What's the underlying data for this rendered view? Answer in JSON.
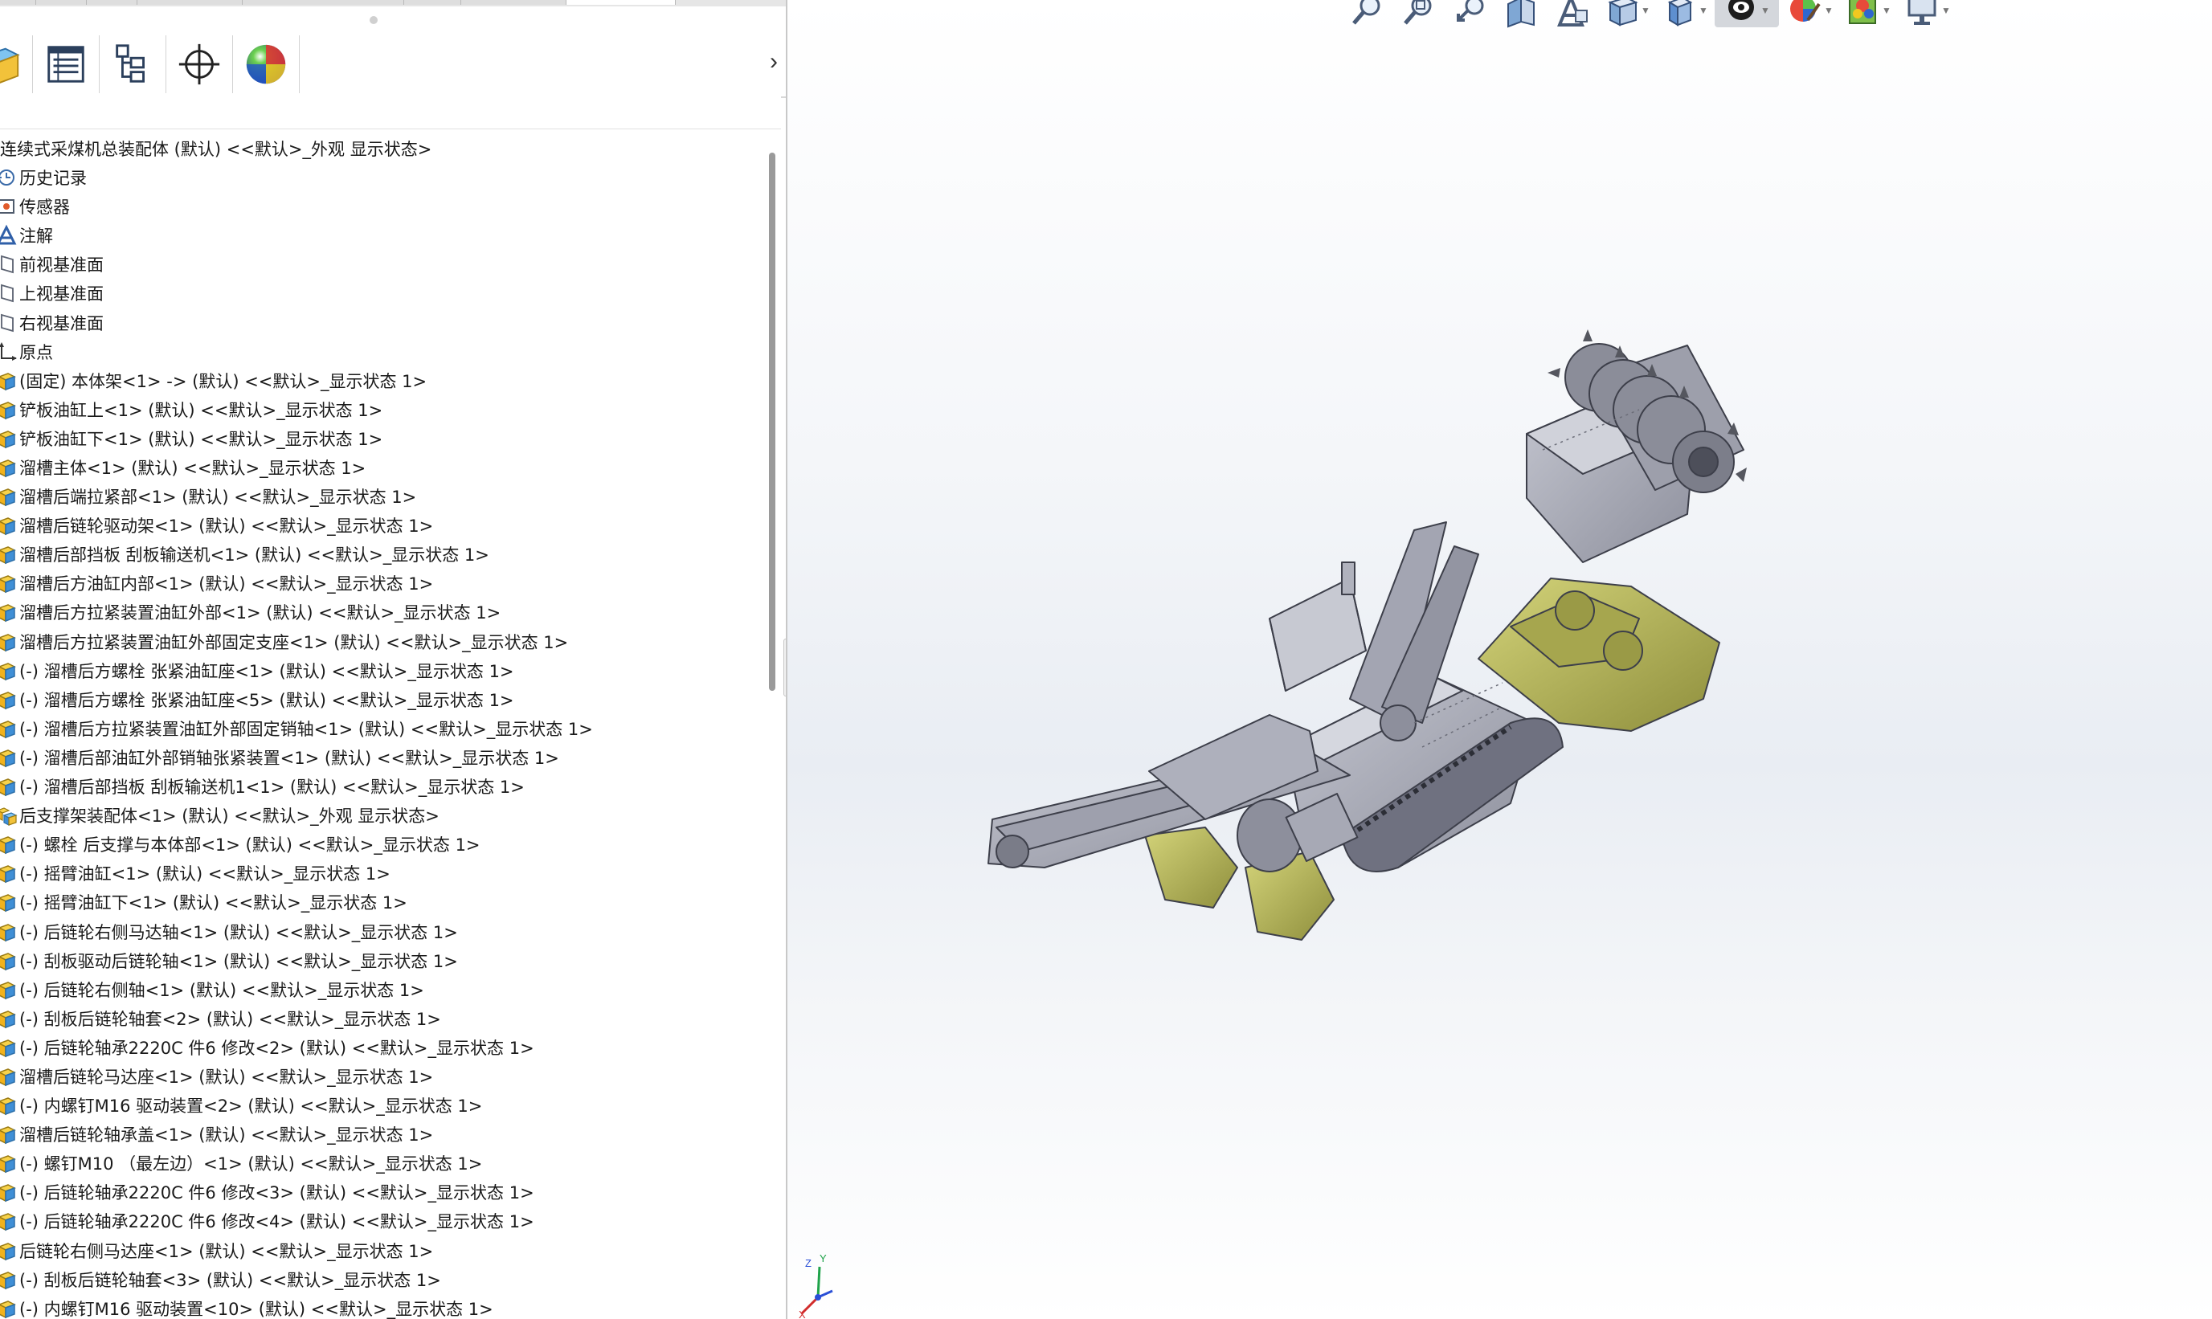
{
  "panel": {
    "icon_tabs": [
      {
        "name": "featuremanager-tab",
        "icon": "part-cube-icon"
      },
      {
        "name": "propertymanager-tab",
        "icon": "property-list-icon"
      },
      {
        "name": "configurationmanager-tab",
        "icon": "configuration-tree-icon"
      },
      {
        "name": "dimxpert-tab",
        "icon": "crosshair-icon"
      },
      {
        "name": "display-manager-tab",
        "icon": "color-sphere-icon"
      }
    ],
    "expand_glyph": "›",
    "filter_placeholder": ""
  },
  "tree": {
    "root": "连续式采煤机总装配体 (默认) <<默认>_外观 显示状态>",
    "items": [
      {
        "label": "历史记录",
        "icon": "history-icon"
      },
      {
        "label": "传感器",
        "icon": "sensor-icon"
      },
      {
        "label": "注解",
        "icon": "annotation-icon"
      },
      {
        "label": "前视基准面",
        "icon": "plane-icon"
      },
      {
        "label": "上视基准面",
        "icon": "plane-icon"
      },
      {
        "label": "右视基准面",
        "icon": "plane-icon"
      },
      {
        "label": "原点",
        "icon": "origin-icon"
      },
      {
        "label": "(固定) 本体架<1> -> (默认) <<默认>_显示状态 1>",
        "icon": "part-icon"
      },
      {
        "label": "铲板油缸上<1> (默认) <<默认>_显示状态 1>",
        "icon": "part-icon"
      },
      {
        "label": "铲板油缸下<1> (默认) <<默认>_显示状态 1>",
        "icon": "part-icon"
      },
      {
        "label": "溜槽主体<1> (默认) <<默认>_显示状态 1>",
        "icon": "part-icon"
      },
      {
        "label": "溜槽后端拉紧部<1> (默认) <<默认>_显示状态 1>",
        "icon": "part-icon"
      },
      {
        "label": "溜槽后链轮驱动架<1> (默认) <<默认>_显示状态 1>",
        "icon": "part-icon"
      },
      {
        "label": "溜槽后部挡板  刮板输送机<1> (默认) <<默认>_显示状态 1>",
        "icon": "part-icon"
      },
      {
        "label": "溜槽后方油缸内部<1> (默认) <<默认>_显示状态 1>",
        "icon": "part-icon"
      },
      {
        "label": "溜槽后方拉紧装置油缸外部<1> (默认) <<默认>_显示状态 1>",
        "icon": "part-icon"
      },
      {
        "label": "溜槽后方拉紧装置油缸外部固定支座<1> (默认) <<默认>_显示状态 1>",
        "icon": "part-icon"
      },
      {
        "label": "(-) 溜槽后方螺栓 张紧油缸座<1> (默认) <<默认>_显示状态 1>",
        "icon": "part-icon"
      },
      {
        "label": "(-) 溜槽后方螺栓 张紧油缸座<5> (默认) <<默认>_显示状态 1>",
        "icon": "part-icon"
      },
      {
        "label": "(-) 溜槽后方拉紧装置油缸外部固定销轴<1> (默认) <<默认>_显示状态 1>",
        "icon": "part-icon"
      },
      {
        "label": "(-) 溜槽后部油缸外部销轴张紧装置<1> (默认) <<默认>_显示状态 1>",
        "icon": "part-icon"
      },
      {
        "label": "(-) 溜槽后部挡板  刮板输送机1<1> (默认) <<默认>_显示状态 1>",
        "icon": "part-icon"
      },
      {
        "label": "后支撑架装配体<1> (默认) <<默认>_外观 显示状态>",
        "icon": "assembly-icon"
      },
      {
        "label": "(-) 螺栓 后支撑与本体部<1> (默认) <<默认>_显示状态 1>",
        "icon": "part-icon"
      },
      {
        "label": "(-) 摇臂油缸<1> (默认) <<默认>_显示状态 1>",
        "icon": "part-icon"
      },
      {
        "label": "(-) 摇臂油缸下<1> (默认) <<默认>_显示状态 1>",
        "icon": "part-icon"
      },
      {
        "label": "(-) 后链轮右侧马达轴<1> (默认) <<默认>_显示状态 1>",
        "icon": "part-icon"
      },
      {
        "label": "(-) 刮板驱动后链轮轴<1> (默认) <<默认>_显示状态 1>",
        "icon": "part-icon"
      },
      {
        "label": "(-) 后链轮右侧轴<1> (默认) <<默认>_显示状态 1>",
        "icon": "part-icon"
      },
      {
        "label": "(-) 刮板后链轮轴套<2> (默认) <<默认>_显示状态 1>",
        "icon": "part-icon"
      },
      {
        "label": "(-) 后链轮轴承2220C 件6  修改<2> (默认) <<默认>_显示状态 1>",
        "icon": "part-icon"
      },
      {
        "label": "溜槽后链轮马达座<1> (默认) <<默认>_显示状态 1>",
        "icon": "part-icon"
      },
      {
        "label": "(-) 内螺钉M16 驱动装置<2> (默认) <<默认>_显示状态 1>",
        "icon": "part-icon"
      },
      {
        "label": "溜槽后链轮轴承盖<1> (默认) <<默认>_显示状态 1>",
        "icon": "part-icon"
      },
      {
        "label": "(-) 螺钉M10  （最左边）<1> (默认) <<默认>_显示状态 1>",
        "icon": "part-icon"
      },
      {
        "label": "(-) 后链轮轴承2220C 件6  修改<3> (默认) <<默认>_显示状态 1>",
        "icon": "part-icon"
      },
      {
        "label": "(-) 后链轮轴承2220C 件6  修改<4> (默认) <<默认>_显示状态 1>",
        "icon": "part-icon"
      },
      {
        "label": "后链轮右侧马达座<1> (默认) <<默认>_显示状态 1>",
        "icon": "part-icon"
      },
      {
        "label": "(-) 刮板后链轮轴套<3> (默认) <<默认>_显示状态 1>",
        "icon": "part-icon"
      },
      {
        "label": "(-) 内螺钉M16 驱动装置<10> (默认) <<默认>_显示状态 1>",
        "icon": "part-icon"
      }
    ]
  },
  "view_toolbar": [
    {
      "name": "zoom-to-fit-button",
      "icon": "zoom-fit-icon"
    },
    {
      "name": "zoom-to-area-button",
      "icon": "zoom-area-icon"
    },
    {
      "name": "previous-view-button",
      "icon": "previous-view-icon"
    },
    {
      "name": "section-view-button",
      "icon": "section-view-icon"
    },
    {
      "name": "dynamic-annotation-button",
      "icon": "annotation-view-icon"
    },
    {
      "name": "view-orientation-button",
      "icon": "view-orientation-icon"
    },
    {
      "name": "display-style-button",
      "icon": "display-style-icon"
    },
    {
      "name": "hide-show-items-button",
      "icon": "hide-show-eye-icon"
    },
    {
      "name": "edit-appearance-button",
      "icon": "edit-appearance-icon"
    },
    {
      "name": "apply-scene-button",
      "icon": "scene-icon"
    },
    {
      "name": "view-settings-button",
      "icon": "monitor-icon"
    }
  ],
  "triad": {
    "x": "X",
    "y": "Y",
    "z": "Z"
  },
  "colors": {
    "model_gray": "#a6a8b4",
    "model_dark": "#6f7180",
    "model_yellow": "#b9b95a",
    "accent_blue": "#2a67c9"
  }
}
